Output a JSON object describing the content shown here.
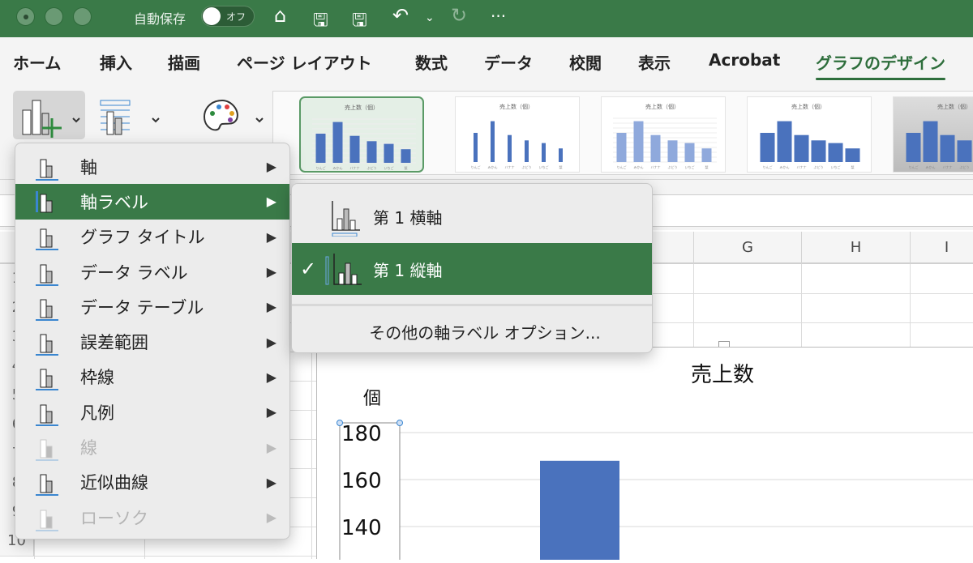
{
  "titlebar": {
    "autosave_label": "自動保存",
    "autosave_state": "オフ",
    "icons": [
      "home-icon",
      "save-icon",
      "save-as-icon",
      "undo-icon",
      "redo-icon",
      "more-icon"
    ]
  },
  "tabs": [
    {
      "label": "ホーム"
    },
    {
      "label": "挿入"
    },
    {
      "label": "描画"
    },
    {
      "label": "ページ レイアウト"
    },
    {
      "label": "数式"
    },
    {
      "label": "データ"
    },
    {
      "label": "校閲"
    },
    {
      "label": "表示"
    },
    {
      "label": "Acrobat"
    },
    {
      "label": "グラフのデザイン",
      "active": true
    }
  ],
  "thumb_chart": {
    "title": "売上数（個）",
    "categories": [
      "りんご",
      "みかん",
      "バナナ",
      "ぶどう",
      "いちご",
      "梨"
    ],
    "values": [
      120,
      168,
      111,
      89,
      78,
      56
    ],
    "ymax": 180
  },
  "menu": {
    "items": [
      {
        "label": "軸",
        "enabled": true
      },
      {
        "label": "軸ラベル",
        "enabled": true,
        "highlighted": true
      },
      {
        "label": "グラフ タイトル",
        "enabled": true
      },
      {
        "label": "データ ラベル",
        "enabled": true
      },
      {
        "label": "データ テーブル",
        "enabled": true
      },
      {
        "label": "誤差範囲",
        "enabled": true
      },
      {
        "label": "枠線",
        "enabled": true
      },
      {
        "label": "凡例",
        "enabled": true
      },
      {
        "label": "線",
        "enabled": false
      },
      {
        "label": "近似曲線",
        "enabled": true
      },
      {
        "label": "ローソク",
        "enabled": false
      }
    ]
  },
  "submenu": {
    "items": [
      {
        "label": "第 1 横軸",
        "checked": false
      },
      {
        "label": "第 1 縦軸",
        "checked": true
      }
    ],
    "more": "その他の軸ラベル オプション...",
    "check": "✓"
  },
  "sheet": {
    "columns": [
      "G",
      "H",
      "I"
    ],
    "rows": [
      "1",
      "2",
      "3",
      "4",
      "5",
      "6",
      "7",
      "8",
      "9",
      "10"
    ]
  },
  "chart_data": {
    "type": "bar",
    "title": "売上数",
    "ylabel": "個",
    "yticks": [
      180,
      160,
      140
    ],
    "ylim_visible": [
      130,
      180
    ],
    "categories": [
      "りんご",
      "みかん"
    ],
    "values": [
      120,
      168
    ]
  },
  "colors": {
    "accent": "#3a7a48",
    "bar": "#4a72bd"
  }
}
